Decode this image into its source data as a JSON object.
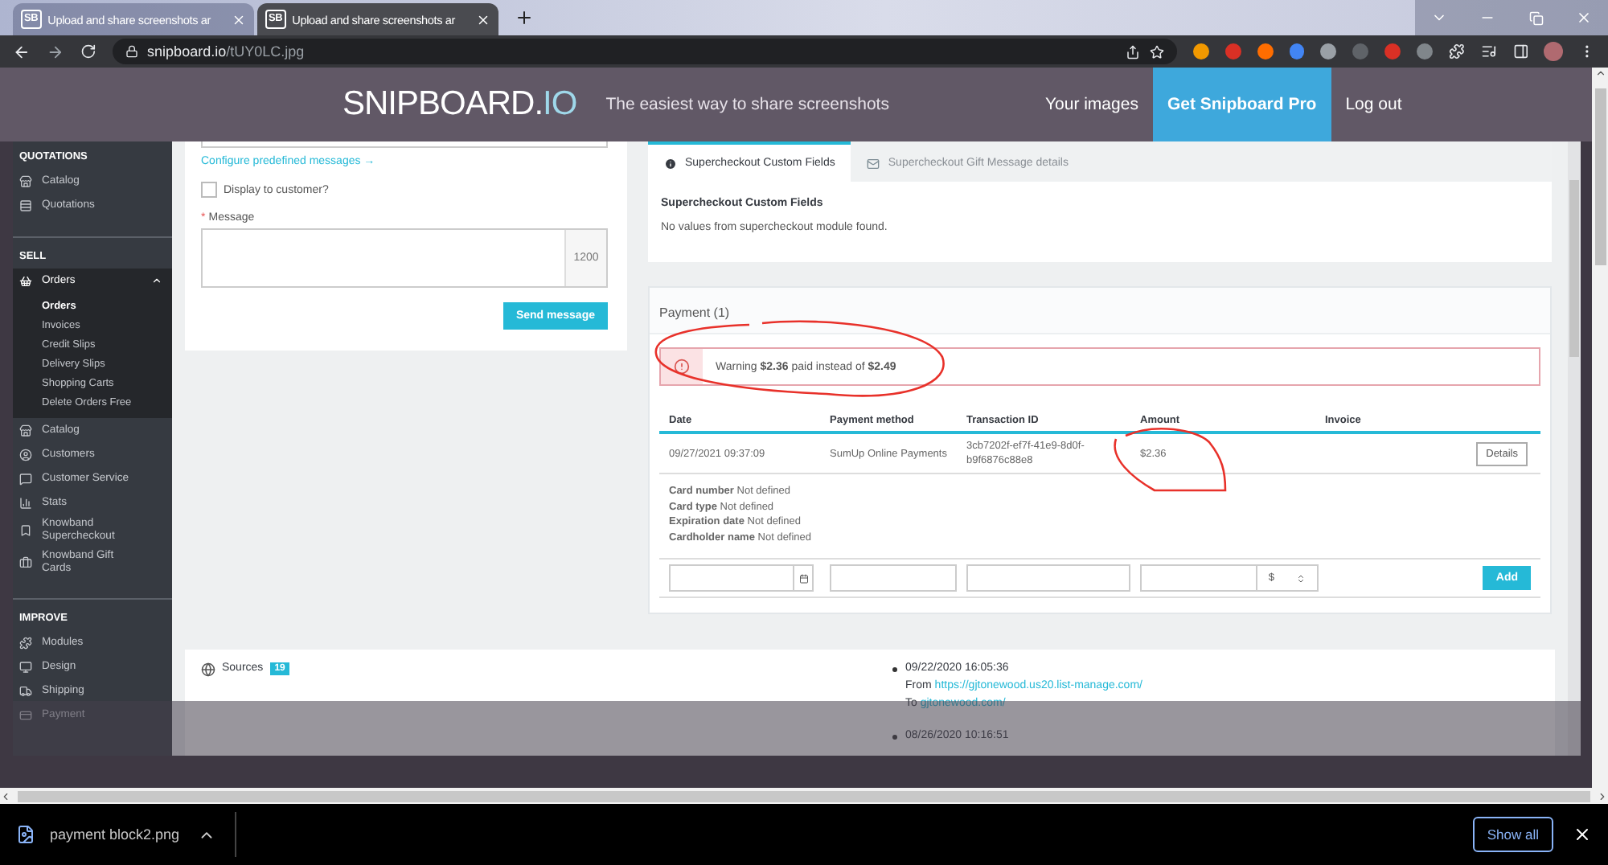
{
  "browser": {
    "tabs": [
      {
        "favicon": "SB",
        "title": "Upload and share screenshots ar",
        "selected": false
      },
      {
        "favicon": "SB",
        "title": "Upload and share screenshots ar",
        "selected": true
      }
    ],
    "url_host": "snipboard.io",
    "url_path": "/tUY0LC.jpg"
  },
  "site_header": {
    "logo": "SNIPBOARD.",
    "logo_suffix": "IO",
    "tagline": "The easiest way to share screenshots",
    "nav": [
      {
        "label": "Your images",
        "selected": false
      },
      {
        "label": "Get Snipboard Pro",
        "selected": true
      },
      {
        "label": "Log out",
        "selected": false
      }
    ]
  },
  "screenshot": {
    "sidebar": [
      {
        "heading": "QUOTATIONS",
        "items": [
          {
            "label": "Catalog",
            "selected": false
          },
          {
            "label": "Quotations",
            "selected": false
          }
        ]
      },
      {
        "heading": "SELL",
        "items": [
          {
            "label": "Orders",
            "selected": true,
            "expanded": true,
            "children": [
              {
                "label": "Orders",
                "selected": true
              },
              {
                "label": "Invoices",
                "selected": false
              },
              {
                "label": "Credit Slips",
                "selected": false
              },
              {
                "label": "Delivery Slips",
                "selected": false
              },
              {
                "label": "Shopping Carts",
                "selected": false
              },
              {
                "label": "Delete Orders Free",
                "selected": false
              }
            ]
          },
          {
            "label": "Catalog",
            "selected": false
          },
          {
            "label": "Customers",
            "selected": false
          },
          {
            "label": "Customer Service",
            "selected": false
          },
          {
            "label": "Stats",
            "selected": false
          },
          {
            "label": "Knowband Supercheckout",
            "selected": false
          },
          {
            "label": "Knowband Gift Cards",
            "selected": false
          }
        ]
      },
      {
        "heading": "IMPROVE",
        "items": [
          {
            "label": "Modules",
            "selected": false
          },
          {
            "label": "Design",
            "selected": false
          },
          {
            "label": "Shipping",
            "selected": false
          },
          {
            "label": "Payment",
            "selected": false
          }
        ]
      }
    ],
    "message_form": {
      "link": "Configure predefined messages →",
      "checkbox": {
        "label": "Display to customer?",
        "checked": false
      },
      "required_mark": "*",
      "message_label": "Message",
      "counter": "1200",
      "button": "Send message"
    },
    "custom_fields": {
      "tabs": [
        {
          "label": "Supercheckout Custom Fields",
          "selected": true
        },
        {
          "label": "Supercheckout Gift Message details",
          "selected": false
        }
      ],
      "heading": "Supercheckout Custom Fields",
      "text": "No values from supercheckout module found."
    },
    "payment": {
      "title": "Payment (1)",
      "warning": "Warning **$2.36** paid instead of **$2.49**",
      "columns": [
        "Date",
        "Payment method",
        "Transaction ID",
        "Amount",
        "Invoice"
      ],
      "rows": [
        {
          "cells": [
            "09/27/2021 09:37:09",
            "SumUp Online Payments",
            "3cb7202f-ef7f-41e9-8d0f-b9f6876c88e8",
            "$2.36"
          ],
          "button": "Details"
        }
      ],
      "card_details": [
        {
          "label": "Card number",
          "value": "Not defined"
        },
        {
          "label": "Card type",
          "value": "Not defined"
        },
        {
          "label": "Expiration date",
          "value": "Not defined"
        },
        {
          "label": "Cardholder name",
          "value": "Not defined"
        }
      ],
      "new_payment": {
        "currency": "$",
        "button": "Add"
      }
    },
    "sources": {
      "title": "Sources",
      "count": "19",
      "entries": [
        {
          "date": "09/22/2020 16:05:36",
          "from_label": "From",
          "from": "https://gjtonewood.us20.list-manage.com/",
          "to_label": "To",
          "to": "gjtonewood.com/"
        },
        {
          "date": "08/26/2020 10:16:51"
        }
      ]
    }
  },
  "downloads": {
    "file": "payment block2.png",
    "show_all": "Show all"
  }
}
